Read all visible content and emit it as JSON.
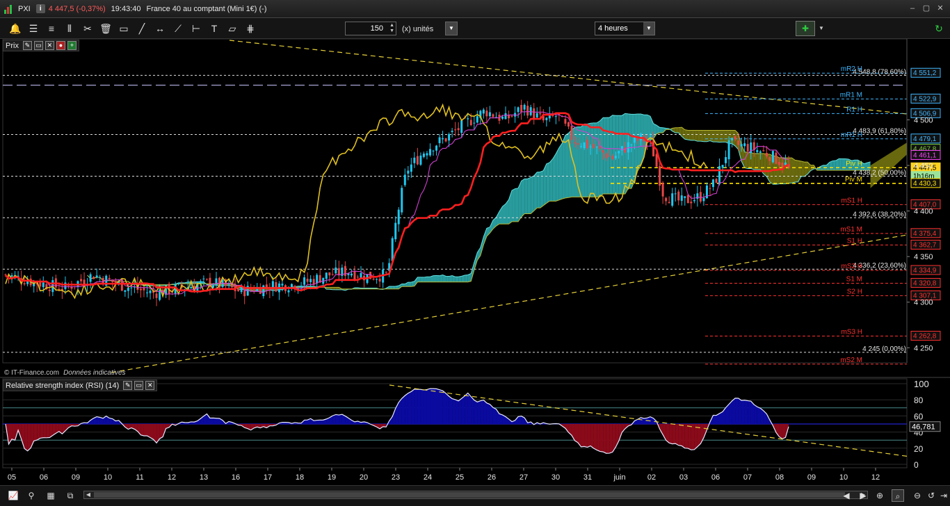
{
  "window": {
    "symbol": "PXI",
    "info_badge": "i",
    "change": "4 447,5 (-0,37%)",
    "time": "19:43:40",
    "instrument": "France 40 au comptant (Mini 1€) (-)",
    "buttons": [
      "‒",
      "▢",
      "✕"
    ]
  },
  "toolbar": {
    "tools": [
      {
        "name": "alert-icon",
        "glyph": "🔔"
      },
      {
        "name": "fibonacci-icon",
        "glyph": "☰"
      },
      {
        "name": "fib-fan-icon",
        "glyph": "≡"
      },
      {
        "name": "fib-time-icon",
        "glyph": "⫴"
      },
      {
        "name": "tools-icon",
        "glyph": "✂"
      },
      {
        "name": "trash-icon",
        "glyph": "🗑"
      },
      {
        "name": "rectangle-tool-icon",
        "glyph": "▭"
      },
      {
        "name": "line-tool-icon",
        "glyph": "╱"
      },
      {
        "name": "segment-tool-icon",
        "glyph": "↔"
      },
      {
        "name": "trendline-tool-icon",
        "glyph": "⟋"
      },
      {
        "name": "horizontal-line-icon",
        "glyph": "⊢"
      },
      {
        "name": "text-tool-icon",
        "glyph": "T"
      },
      {
        "name": "channel-tool-icon",
        "glyph": "▱"
      },
      {
        "name": "pitchfork-tool-icon",
        "glyph": "⋕"
      }
    ],
    "bars_value": "150",
    "bars_unit": "(x) unités",
    "period": "4 heures"
  },
  "price_panel": {
    "title": "Prix",
    "y_ticks": [
      "4 500",
      "4 450",
      "4 400",
      "4 350",
      "4 300",
      "4 250"
    ],
    "badges": [
      {
        "text": "4 551,2",
        "value": 4551.2,
        "color": "#3fb6ff",
        "fill": "#111"
      },
      {
        "text": "4 522,9",
        "value": 4522.9,
        "color": "#3fb6ff",
        "fill": "#111"
      },
      {
        "text": "4 506,9",
        "value": 4506.9,
        "color": "#3fb6ff",
        "fill": "#111"
      },
      {
        "text": "4 479,1",
        "value": 4479.1,
        "color": "#3fb6ff",
        "fill": "#111"
      },
      {
        "text": "4 467,8",
        "value": 4467.8,
        "color": "#7ccd3a",
        "fill": "#111"
      },
      {
        "text": "4 461,1",
        "value": 4461.1,
        "color": "#ff44ff",
        "fill": "#111"
      },
      {
        "text": "4 447,5",
        "value": 4447.5,
        "color": "#000",
        "fill": "#ffd21e"
      },
      {
        "text": "1h16m",
        "value": 4438.0,
        "color": "#000",
        "fill": "#9be59b"
      },
      {
        "text": "4 430,3",
        "value": 4430.3,
        "color": "#ffe100",
        "fill": "#111"
      },
      {
        "text": "4 407,0",
        "value": 4407.0,
        "color": "#ff3030",
        "fill": "#111"
      },
      {
        "text": "4 375,4",
        "value": 4375.4,
        "color": "#ff3030",
        "fill": "#111"
      },
      {
        "text": "4 362,7",
        "value": 4362.7,
        "color": "#ff3030",
        "fill": "#111"
      },
      {
        "text": "4 334,9",
        "value": 4334.9,
        "color": "#ff3030",
        "fill": "#111"
      },
      {
        "text": "4 320,8",
        "value": 4320.8,
        "color": "#ff3030",
        "fill": "#111"
      },
      {
        "text": "4 307,1",
        "value": 4307.1,
        "color": "#ff3030",
        "fill": "#111"
      },
      {
        "text": "4 262,8",
        "value": 4262.8,
        "color": "#ff3030",
        "fill": "#111"
      }
    ],
    "fib_levels": [
      {
        "label": "4 548,8 (78,60%)",
        "value": 4548.8
      },
      {
        "label": "4 483,9 (61,80%)",
        "value": 4483.9
      },
      {
        "label": "4 438,2 (50,00%)",
        "value": 4438.2
      },
      {
        "label": "4 392,6 (38,20%)",
        "value": 4392.6
      },
      {
        "label": "4 336,2 (23,60%)",
        "value": 4336.2
      },
      {
        "label": "4 245 (0,00%)",
        "value": 4245.0
      }
    ],
    "pivot_levels": [
      {
        "label": "mR2 H",
        "value": 4551.2,
        "color": "#3fb6ff"
      },
      {
        "label": "mR1 M",
        "value": 4522.9,
        "color": "#3fb6ff"
      },
      {
        "label": "R1 H",
        "value": 4506.9,
        "color": "#3fb6ff"
      },
      {
        "label": "mR1 H",
        "value": 4479.1,
        "color": "#3fb6ff"
      },
      {
        "label": "Piv H",
        "value": 4447.5,
        "color": "#ffe100"
      },
      {
        "label": "Piv M",
        "value": 4430.3,
        "color": "#ffe100"
      },
      {
        "label": "mS1 H",
        "value": 4407.0,
        "color": "#ff3030"
      },
      {
        "label": "mS1 M",
        "value": 4375.4,
        "color": "#ff3030"
      },
      {
        "label": "S1 H",
        "value": 4362.7,
        "color": "#ff3030"
      },
      {
        "label": "mS2 H",
        "value": 4334.9,
        "color": "#ff3030"
      },
      {
        "label": "S1 M",
        "value": 4320.8,
        "color": "#ff3030"
      },
      {
        "label": "S2 H",
        "value": 4307.1,
        "color": "#ff3030"
      },
      {
        "label": "mS3 H",
        "value": 4262.8,
        "color": "#ff3030"
      },
      {
        "label": "mS2 M",
        "value": 4232.0,
        "color": "#ff3030"
      }
    ],
    "copyright": "© IT-Finance.com",
    "disclaimer": "Données indicatives"
  },
  "rsi_panel": {
    "title": "Relative strength index (RSI) (14)",
    "y_ticks": [
      "100",
      "80",
      "60",
      "40",
      "20",
      "0"
    ],
    "current_value": "46,781"
  },
  "x_axis": {
    "labels": [
      "05",
      "06",
      "09",
      "10",
      "11",
      "12",
      "13",
      "16",
      "17",
      "18",
      "19",
      "20",
      "23",
      "24",
      "25",
      "26",
      "27",
      "30",
      "31",
      "juin",
      "02",
      "03",
      "06",
      "07",
      "08",
      "09",
      "10",
      "12"
    ]
  },
  "bottom_bar": {
    "left_icons": [
      "chart-type-icon",
      "indicator-icon",
      "template-icon",
      "compare-icon"
    ],
    "right_icons": [
      "scroll-left-icon",
      "scroll-right-icon",
      "zoom-in-icon",
      "zoom-out-icon",
      "zoom-search-icon",
      "reset-icon",
      "pan-right-icon"
    ]
  },
  "chart_data": {
    "type": "candlestick",
    "price_range": [
      4235,
      4575
    ],
    "rsi_range": [
      0,
      100
    ],
    "rsi_current": 46.781,
    "colors": {
      "up": "#1ec8f0",
      "down": "#e64646",
      "tenkan": "#e0c020",
      "kijun": "#ff1f1f",
      "cloud_bull": "#2fb6b8",
      "cloud_bear": "#7a7a10",
      "ma": "#d040d0"
    }
  }
}
